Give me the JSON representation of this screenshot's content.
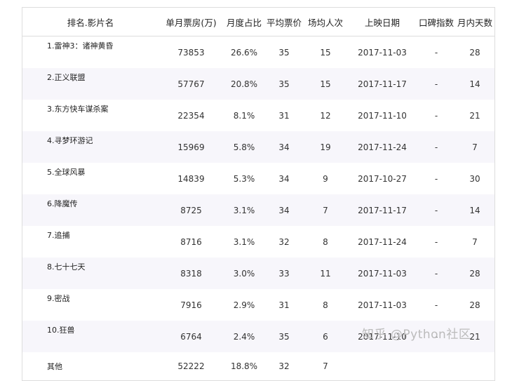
{
  "columns": [
    "排名.影片名",
    "单月票房(万)",
    "月度占比",
    "平均票价",
    "场均人次",
    "上映日期",
    "口碑指数",
    "月内天数"
  ],
  "rows": [
    {
      "name": "1.雷神3：诸神黄昏",
      "box": "73853",
      "share": "26.6%",
      "price": "35",
      "attendance": "15",
      "date": "2017-11-03",
      "score": "-",
      "days": "28"
    },
    {
      "name": "2.正义联盟",
      "box": "57767",
      "share": "20.8%",
      "price": "35",
      "attendance": "15",
      "date": "2017-11-17",
      "score": "-",
      "days": "14"
    },
    {
      "name": "3.东方快车谋杀案",
      "box": "22354",
      "share": "8.1%",
      "price": "31",
      "attendance": "12",
      "date": "2017-11-10",
      "score": "-",
      "days": "21"
    },
    {
      "name": "4.寻梦环游记",
      "box": "15969",
      "share": "5.8%",
      "price": "34",
      "attendance": "19",
      "date": "2017-11-24",
      "score": "-",
      "days": "7"
    },
    {
      "name": "5.全球风暴",
      "box": "14839",
      "share": "5.3%",
      "price": "34",
      "attendance": "9",
      "date": "2017-10-27",
      "score": "-",
      "days": "30"
    },
    {
      "name": "6.降魔传",
      "box": "8725",
      "share": "3.1%",
      "price": "34",
      "attendance": "7",
      "date": "2017-11-17",
      "score": "-",
      "days": "14"
    },
    {
      "name": "7.追捕",
      "box": "8716",
      "share": "3.1%",
      "price": "32",
      "attendance": "8",
      "date": "2017-11-24",
      "score": "-",
      "days": "7"
    },
    {
      "name": "8.七十七天",
      "box": "8318",
      "share": "3.0%",
      "price": "33",
      "attendance": "11",
      "date": "2017-11-03",
      "score": "-",
      "days": "28"
    },
    {
      "name": "9.密战",
      "box": "7916",
      "share": "2.9%",
      "price": "31",
      "attendance": "8",
      "date": "2017-11-03",
      "score": "-",
      "days": "28"
    },
    {
      "name": "10.狂兽",
      "box": "6764",
      "share": "2.4%",
      "price": "35",
      "attendance": "6",
      "date": "2017-11-10",
      "score": "-",
      "days": "21"
    },
    {
      "name": "其他",
      "box": "52222",
      "share": "18.8%",
      "price": "32",
      "attendance": "7",
      "date": "",
      "score": "",
      "days": ""
    }
  ],
  "watermark": "知乎 @Python社区"
}
